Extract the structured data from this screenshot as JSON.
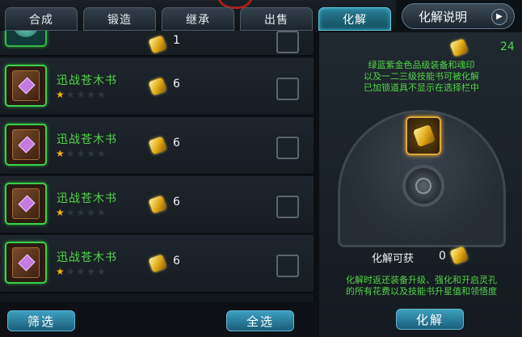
{
  "tabs": [
    {
      "label": "合成",
      "active": false
    },
    {
      "label": "锻造",
      "active": false
    },
    {
      "label": "继承",
      "active": false
    },
    {
      "label": "出售",
      "active": false
    },
    {
      "label": "化解",
      "active": true
    }
  ],
  "help_button": {
    "label": "化解说明",
    "icon": "chevron-right-icon"
  },
  "list": {
    "partial_item": {
      "quantity": "1",
      "icon": "gem-orb-icon"
    },
    "items": [
      {
        "name": "迅战苍木书",
        "stars": 1,
        "max_stars": 5,
        "currency_icon": "gold-ingot-icon",
        "quantity": "6",
        "checked": false
      },
      {
        "name": "迅战苍木书",
        "stars": 1,
        "max_stars": 5,
        "currency_icon": "gold-ingot-icon",
        "quantity": "6",
        "checked": false
      },
      {
        "name": "迅战苍木书",
        "stars": 1,
        "max_stars": 5,
        "currency_icon": "gold-ingot-icon",
        "quantity": "6",
        "checked": false
      },
      {
        "name": "迅战苍木书",
        "stars": 1,
        "max_stars": 5,
        "currency_icon": "gold-ingot-icon",
        "quantity": "6",
        "checked": false
      }
    ]
  },
  "bottom": {
    "filter_label": "筛选",
    "select_all_label": "全选"
  },
  "panel": {
    "owned_count": "24",
    "description_lines": [
      "绿蓝紫金色品级装备和魂印",
      "以及一二三级技能书可被化解",
      "已加锁道具不显示在选择栏中"
    ],
    "gain_label": "化解可获",
    "gain_value": "0",
    "note_lines": [
      "化解时返还装备升级、强化和开启灵孔",
      "的所有花费以及技能书升星值和领悟度"
    ],
    "action_label": "化解"
  },
  "colors": {
    "item_name": "#53d44a",
    "accent": "#3d9fbf",
    "gold": "#e0a712"
  }
}
